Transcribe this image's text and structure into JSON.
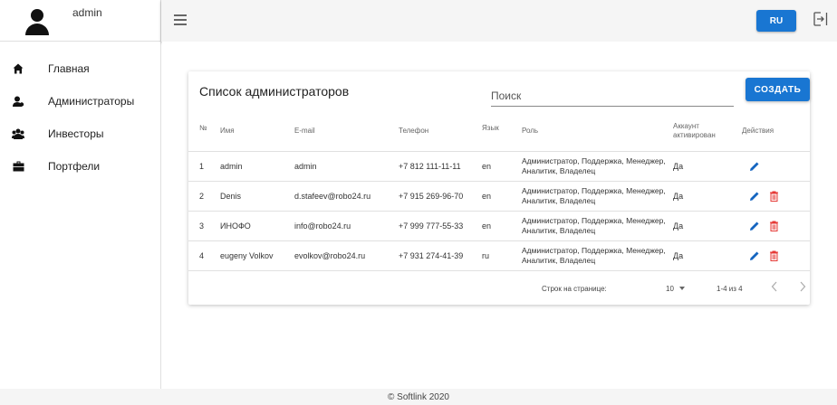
{
  "sidebar": {
    "username": "admin",
    "items": [
      {
        "label": "Главная",
        "icon": "home-icon"
      },
      {
        "label": "Администраторы",
        "icon": "admins-icon"
      },
      {
        "label": "Инвесторы",
        "icon": "investors-icon"
      },
      {
        "label": "Портфели",
        "icon": "briefcase-icon"
      }
    ]
  },
  "topbar": {
    "lang_label": "RU"
  },
  "card": {
    "title": "Список администраторов",
    "search_placeholder": "Поиск",
    "create_label": "СОЗДАТЬ"
  },
  "table": {
    "headers": {
      "num": "№",
      "name": "Имя",
      "email": "E-mail",
      "phone": "Телефон",
      "lang": "Язык",
      "role": "Роль",
      "active": "Аккаунт активирован",
      "actions": "Действия"
    },
    "rows": [
      {
        "num": "1",
        "name": "admin",
        "email": "admin",
        "phone": "+7 812 111-11-11",
        "lang": "en",
        "role": "Администратор, Поддержка, Менеджер, Аналитик, Владелец",
        "active": "Да",
        "deletable": false
      },
      {
        "num": "2",
        "name": "Denis",
        "email": "d.stafeev@robo24.ru",
        "phone": "+7 915 269-96-70",
        "lang": "en",
        "role": "Администратор, Поддержка, Менеджер, Аналитик, Владелец",
        "active": "Да",
        "deletable": true
      },
      {
        "num": "3",
        "name": "ИНОФО",
        "email": "info@robo24.ru",
        "phone": "+7 999 777-55-33",
        "lang": "en",
        "role": "Администратор, Поддержка, Менеджер, Аналитик, Владелец",
        "active": "Да",
        "deletable": true
      },
      {
        "num": "4",
        "name": "eugeny Volkov",
        "email": "evolkov@robo24.ru",
        "phone": "+7 931 274-41-39",
        "lang": "ru",
        "role": "Администратор, Поддержка, Менеджер, Аналитик, Владелец",
        "active": "Да",
        "deletable": true
      }
    ]
  },
  "pagination": {
    "rows_per_page_label": "Строк на странице:",
    "rows_per_page_value": "10",
    "range": "1-4 из 4"
  },
  "footer": {
    "text": "© Softlink 2020"
  },
  "colors": {
    "accent": "#1976d2",
    "delete": "#e53935",
    "edit": "#1565c0"
  }
}
